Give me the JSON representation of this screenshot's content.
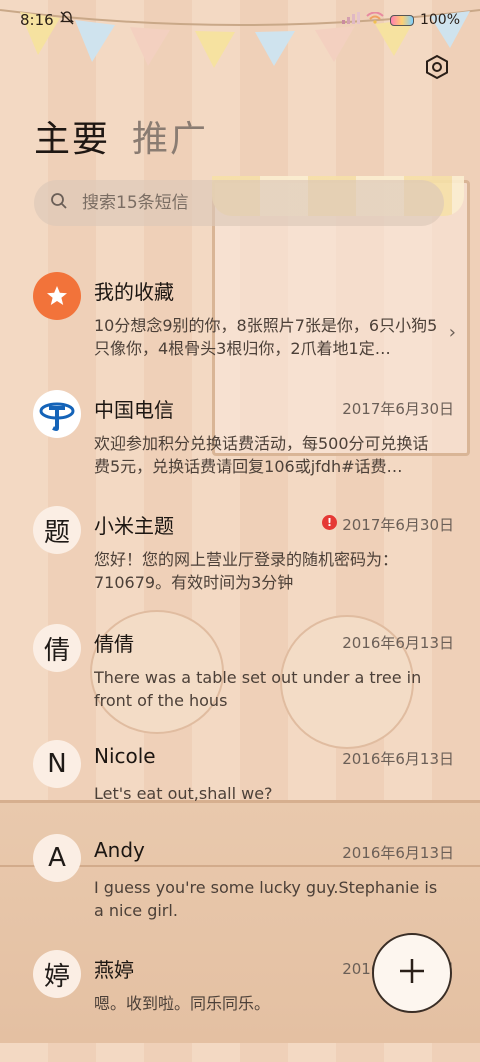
{
  "status_bar": {
    "time": "8:16",
    "battery": "100%"
  },
  "header": {
    "settings_icon": "settings-hexagon-icon",
    "tabs": [
      {
        "label": "主要",
        "active": true
      },
      {
        "label": "推广",
        "active": false
      }
    ]
  },
  "search": {
    "placeholder": "搜索15条短信"
  },
  "conversations": [
    {
      "avatar_text": "★",
      "name": "我的收藏",
      "date": "",
      "preview": "10分想念9别的你，8张照片7张是你，6只小狗5只像你，4根骨头3根归你，2爪着地1定…",
      "avatar_color": "#f2733a"
    },
    {
      "avatar_text": "",
      "name": "中国电信",
      "date": "2017年6月30日",
      "preview": "欢迎参加积分兑换话费活动，每500分可兑换话费5元，兑换话费请回复106或jfdh#话费…",
      "avatar_color": "#1463b8"
    },
    {
      "avatar_text": "题",
      "name": "小米主题",
      "date": "2017年6月30日",
      "preview": "您好！您的网上营业厅登录的随机密码为：710679。有效时间为3分钟",
      "alert": "!"
    },
    {
      "avatar_text": "倩",
      "name": "倩倩",
      "date": "2016年6月13日",
      "preview": "There was a table set out under a tree in front of the hous"
    },
    {
      "avatar_text": "N",
      "name": "Nicole",
      "date": "2016年6月13日",
      "preview": "Let's eat out,shall we?"
    },
    {
      "avatar_text": "A",
      "name": "Andy",
      "date": "2016年6月13日",
      "preview": "I guess you're some lucky guy.Stephanie is a nice girl."
    },
    {
      "avatar_text": "婷",
      "name": "燕婷",
      "date": "2016年6月13日",
      "preview": "嗯。收到啦。同乐同乐。"
    }
  ],
  "fab": {
    "icon": "plus-icon"
  }
}
